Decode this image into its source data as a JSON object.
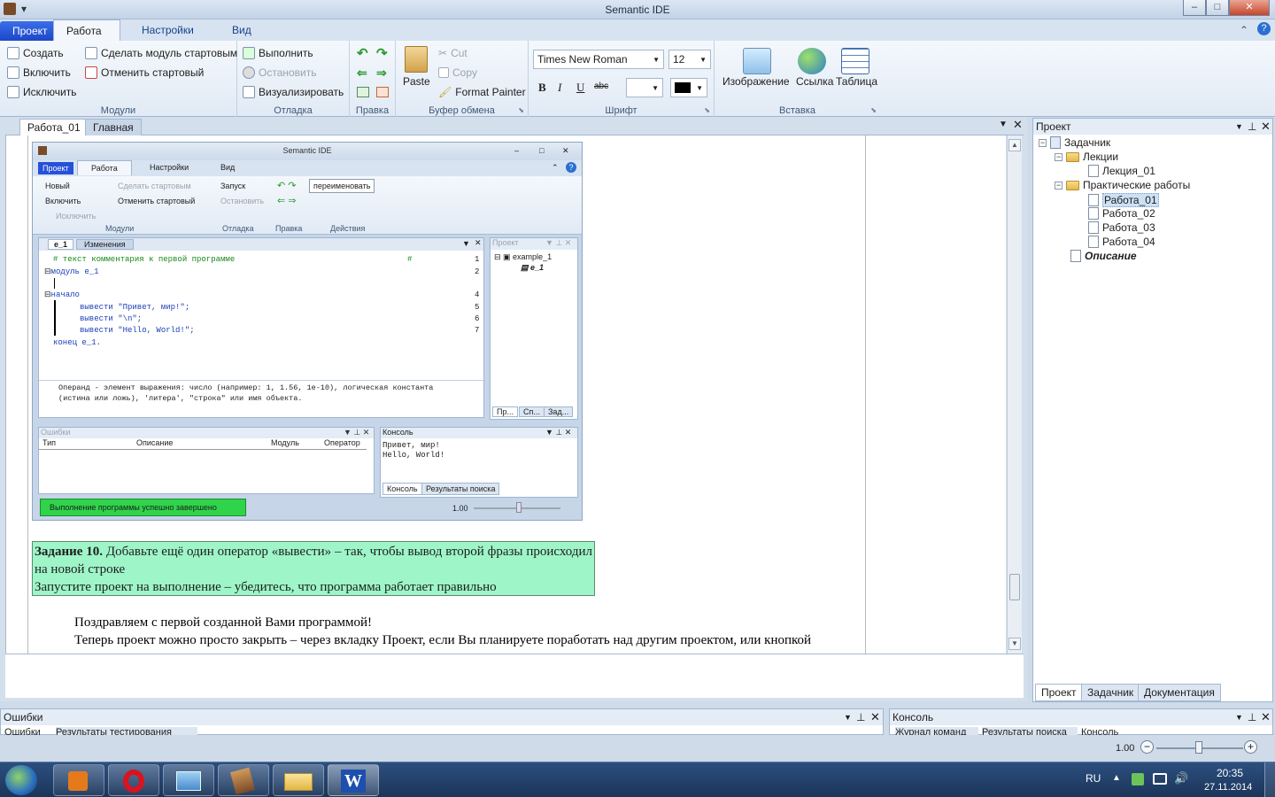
{
  "window": {
    "title": "Semantic IDE"
  },
  "ribbon": {
    "tabs": [
      "Проект",
      "Работа",
      "Настройки",
      "Вид"
    ],
    "groups": {
      "modules": {
        "name": "Модули",
        "create": "Создать",
        "include": "Включить",
        "exclude": "Исключить",
        "make_start": "Сделать модуль стартовым",
        "cancel_start": "Отменить стартовый"
      },
      "debug": {
        "name": "Отладка",
        "run": "Выполнить",
        "stop": "Остановить",
        "visualize": "Визуализировать"
      },
      "edit": {
        "name": "Правка"
      },
      "clipboard": {
        "name": "Буфер обмена",
        "paste": "Paste",
        "cut": "Cut",
        "copy": "Copy",
        "format_painter": "Format Painter"
      },
      "font": {
        "name": "Шрифт",
        "family": "Times New Roman",
        "size": "12",
        "bold": "B",
        "italic": "I",
        "underline": "U",
        "strike": "abc"
      },
      "insert": {
        "name": "Вставка",
        "image": "Изображение",
        "link": "Ссылка",
        "table": "Таблица"
      }
    }
  },
  "doc_tabs": [
    "Работа_01",
    "Главная"
  ],
  "inner": {
    "title": "Semantic IDE",
    "tabs": [
      "Проект",
      "Работа",
      "Настройки",
      "Вид"
    ],
    "ribbon": {
      "new": "Новый",
      "make_start": "Сделать стартовым",
      "include": "Включить",
      "cancel_start": "Отменить стартовый",
      "exclude": "Исключить",
      "run": "Запуск",
      "stop": "Остановить",
      "rename": "переименовать",
      "g_modules": "Модули",
      "g_debug": "Отладка",
      "g_edit": "Правка",
      "g_actions": "Действия"
    },
    "editor_tabs": [
      "e_1",
      "Изменения"
    ],
    "code": [
      {
        "text": "# текст комментария к первой программе",
        "tail": "#",
        "num": "1"
      },
      {
        "text": "модуль e_1",
        "num": "2"
      },
      {
        "text": "",
        "num": ""
      },
      {
        "text": "начало",
        "num": "4"
      },
      {
        "text": "вывести \"Привет, мир!\";",
        "num": "5"
      },
      {
        "text": "вывести \"\\n\";",
        "num": "6"
      },
      {
        "text": "вывести \"Hello, World!\";",
        "num": "7"
      },
      {
        "text": "конец e_1.",
        "num": ""
      }
    ],
    "hint": [
      "Операнд - элемент выражения: число (например: 1, 1.56, 1e-10), логическая константа",
      "(истина или  ложь), 'литера', \"строка\" или имя объекта."
    ],
    "project_panel": {
      "title": "Проект",
      "root": "example_1",
      "child": "e_1",
      "tabs": [
        "Пр...",
        "Сп...",
        "Зад..."
      ]
    },
    "errors_panel": {
      "title": "Ошибки",
      "cols": [
        "Тип",
        "Описание",
        "Модуль",
        "Оператор"
      ]
    },
    "console_panel": {
      "title": "Консоль",
      "lines": [
        "Привет, мир!",
        "Hello, World!"
      ],
      "tabs": [
        "Консоль",
        "Результаты поиска"
      ]
    },
    "status": "Выполнение программы успешно завершено",
    "zoom": "1.00"
  },
  "task": {
    "bold": "Задание 10.",
    "line1": " Добавьте ещё один оператор «вывести» – так, чтобы вывод второй фразы происходил на новой строке",
    "line2": "Запустите проект на выполнение – убедитесь, что программа работает правильно"
  },
  "body": {
    "p1": "Поздравляем с первой созданной Вами программой!",
    "p2": "Теперь проект можно просто закрыть – через вкладку Проект, если Вы планируете поработать над другим проектом, или кнопкой"
  },
  "project_tree": {
    "title": "Проект",
    "root": "Задачник",
    "lectures": "Лекции",
    "lecture_items": [
      "Лекция_01"
    ],
    "practice": "Практические работы",
    "practice_items": [
      "Работа_01",
      "Работа_02",
      "Работа_03",
      "Работа_04"
    ],
    "description": "Описание",
    "tabs": [
      "Проект",
      "Задачник",
      "Документация"
    ]
  },
  "bottom": {
    "errors_title": "Ошибки",
    "errors_tabs": [
      "Ошибки",
      "Результаты тестирования"
    ],
    "console_title": "Консоль",
    "console_tabs": [
      "Журнал команд",
      "Результаты поиска",
      "Консоль"
    ],
    "zoom": "1.00"
  },
  "taskbar": {
    "lang": "RU",
    "time": "20:35",
    "date": "27.11.2014"
  },
  "colors": {
    "accent": "#1c47c8",
    "task_bg": "#9ef5c8",
    "status_ok": "#2fd44a"
  }
}
